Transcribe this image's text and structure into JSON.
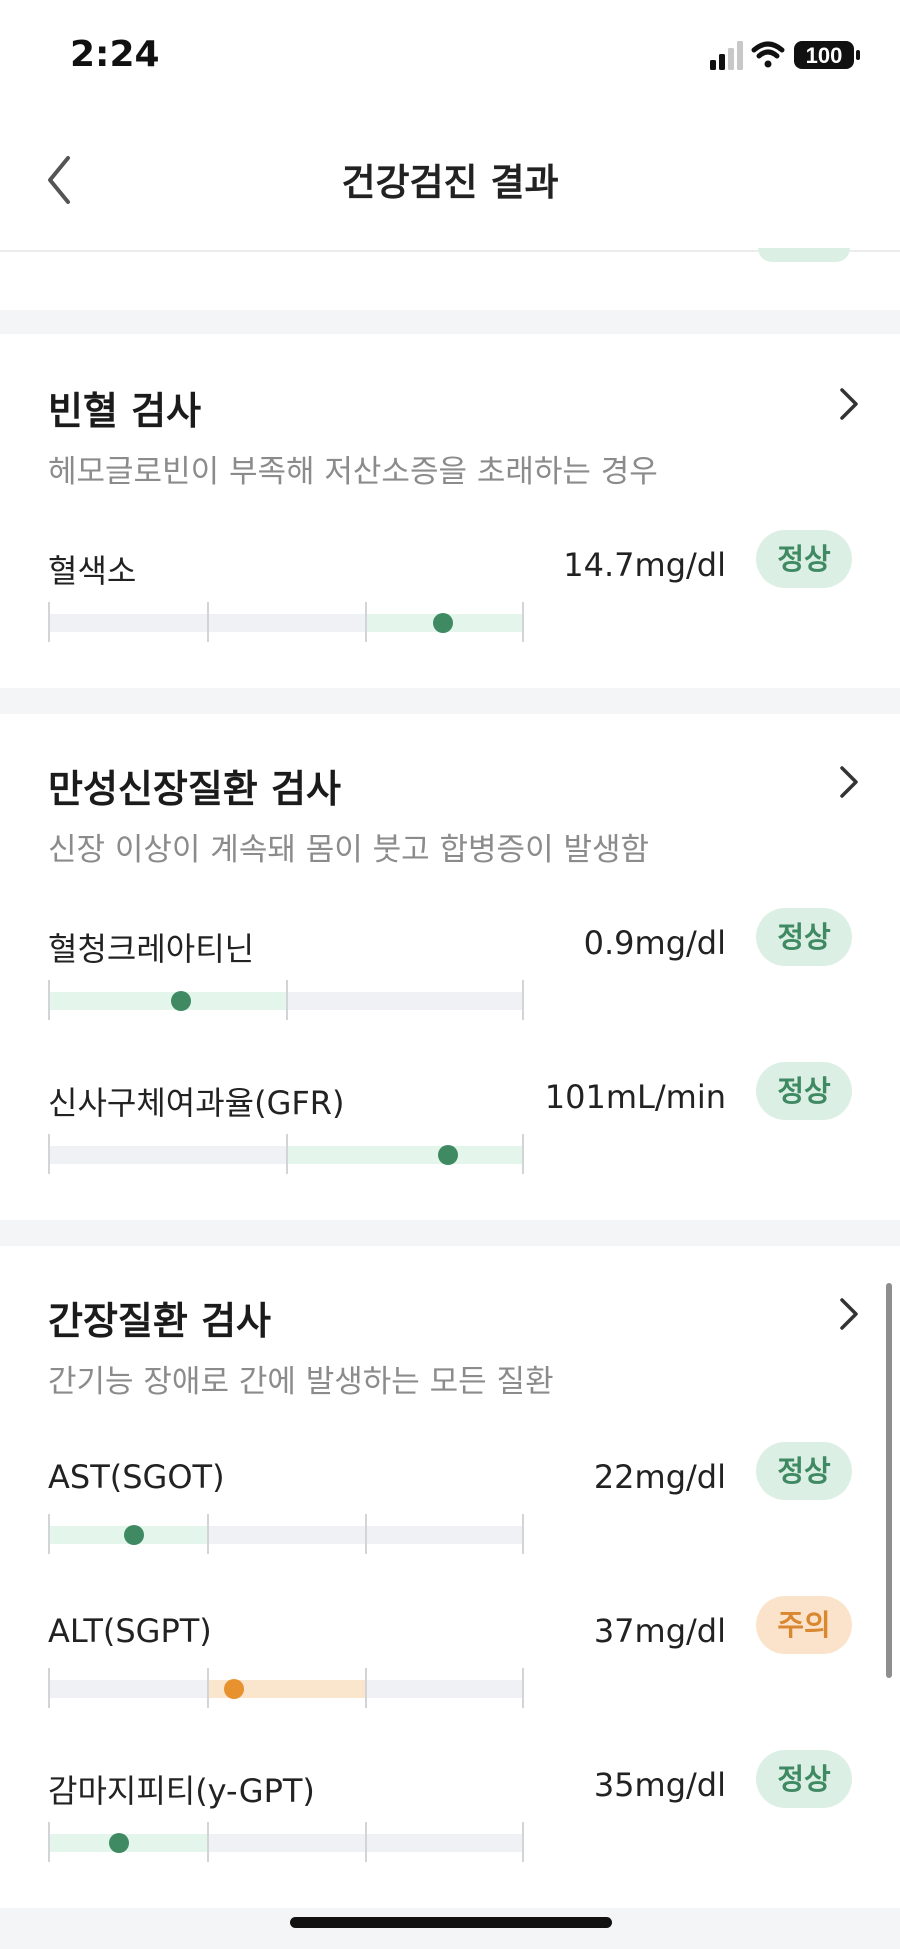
{
  "status": {
    "time": "2:24",
    "battery": "100"
  },
  "nav": {
    "title": "건강검진 결과"
  },
  "colors": {
    "normal": "#3f8a63",
    "normal_fill": "#e4f5ec",
    "warn": "#e8912f",
    "warn_fill": "#fae5cd"
  },
  "sections": [
    {
      "title": "빈혈 검사",
      "description": "헤모글로빈이 부족해 저산소증을 초래하는 경우",
      "items": [
        {
          "name": "혈색소",
          "value": "14.7mg/dl",
          "status": "정상",
          "level": "normal",
          "segments": 3,
          "highlight_segment": 2,
          "marker_fraction": 0.83
        }
      ]
    },
    {
      "title": "만성신장질환 검사",
      "description": "신장 이상이 계속돼 몸이 붓고 합병증이 발생함",
      "items": [
        {
          "name": "혈청크레아티닌",
          "value": "0.9mg/dl",
          "status": "정상",
          "level": "normal",
          "segments": 2,
          "highlight_segment": 0,
          "marker_fraction": 0.28
        },
        {
          "name": "신사구체여과율(GFR)",
          "value": "101mL/min",
          "status": "정상",
          "level": "normal",
          "segments": 2,
          "highlight_segment": 1,
          "marker_fraction": 0.84
        }
      ]
    },
    {
      "title": "간장질환 검사",
      "description": "간기능 장애로 간에 발생하는 모든 질환",
      "items": [
        {
          "name": "AST(SGOT)",
          "value": "22mg/dl",
          "status": "정상",
          "level": "normal",
          "segments": 3,
          "highlight_segment": 0,
          "marker_fraction": 0.18
        },
        {
          "name": "ALT(SGPT)",
          "value": "37mg/dl",
          "status": "주의",
          "level": "warn",
          "segments": 3,
          "highlight_segment": 1,
          "marker_fraction": 0.39
        },
        {
          "name": "감마지피티(y-GPT)",
          "value": "35mg/dl",
          "status": "정상",
          "level": "normal",
          "segments": 3,
          "highlight_segment": 0,
          "marker_fraction": 0.15
        }
      ]
    }
  ]
}
